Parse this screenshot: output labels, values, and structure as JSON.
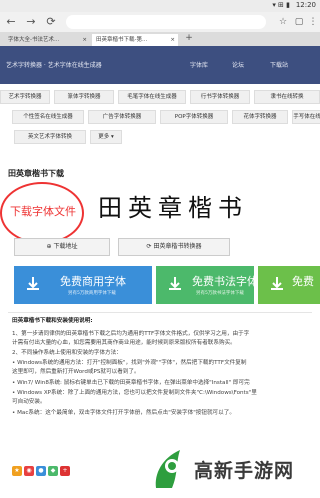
{
  "status": {
    "time": "12:20",
    "icons": "▾ ⊞ ▮"
  },
  "browser": {
    "back_icon": "←",
    "forward_icon": "→",
    "reload_icon": "⟳",
    "tabs": [
      {
        "label": "字体大全-书法艺术..."
      },
      {
        "label": "田英章楷书下载-第..."
      }
    ]
  },
  "header": {
    "logo": "艺术字转换器 · 艺术字体在线生成器",
    "links": [
      "字体库",
      "论坛",
      "下载站"
    ]
  },
  "converters": {
    "row1": [
      "艺术字转换器",
      "篆体字转换器",
      "毛笔字体在线生成器",
      "行书字体转换器",
      "隶书在线转换"
    ],
    "row2": [
      "个性签名在线生成器",
      "广告字体转换器",
      "POP字体转换器",
      "花体字转换器",
      "手写体在线"
    ],
    "row3": [
      "英文艺术字体转换",
      "更多 ▾"
    ]
  },
  "page": {
    "title": "田英章楷书下载",
    "preview_text": "田英章楷书",
    "bubble_text": "下载字体文件",
    "download_address": "⊕ 下载地址",
    "online_converter": "⟳ 田英章楷书转换器"
  },
  "downloads": [
    {
      "main": "免费商用字体",
      "sub": "另有5万款商用字体下载",
      "color": "#3a8fd9"
    },
    {
      "main": "免费书法字体",
      "sub": "另有5万款书法字体下载",
      "color": "#4cb96b"
    },
    {
      "main": "免费",
      "sub": "",
      "color": "#6cc04a"
    }
  ],
  "instructions": {
    "heading": "田英章楷书下载和安装使用说明:",
    "lines": [
      "1、第一步请同律供的田英章楷书下载之后均为通用的TTF字体文件格式，仅供学习之用，由于字",
      "计需有付出大量的心血，如您需要用其商作商业用途，能时候到原来版权所有者联系购买。",
      "2、不同操作系统上使用和安装的字体方法：",
      "• Windows系统的通用方法：打开\"控制面板\"，找到\"外观\"\"字体\"，然后把下载的TTF文件复制",
      "这里即可，然后重新打开Word或PS就可以看到了。",
      "• Win7/ Win8系统: 鼠标右键单击已下载的田英章楷书字体，在弹出菜单中选择\"Install\" 即可完",
      "• Windows XP系统：除了上面的通用方法，您也可以把文件复制到文件夹\"C:\\Windows\\Fonts\"里",
      "可自动安装。",
      "• Mac系统：这个最简单，双击字体文件打开字体册，然后点击\"安装字体\"按钮就可以了。"
    ]
  },
  "watermark": {
    "text": "高新手游网"
  }
}
